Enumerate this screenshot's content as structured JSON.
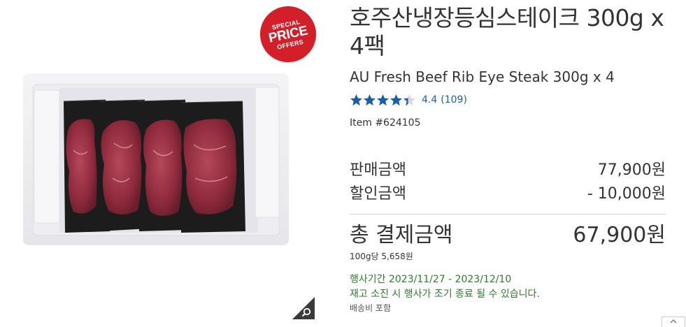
{
  "badge": {
    "line1": "SPECIAL",
    "line2": "PRICE",
    "line3": "OFFERS"
  },
  "product": {
    "title_ko": "호주산냉장등심스테이크 300g x 4팩",
    "title_en": "AU Fresh Beef Rib Eye Steak 300g x 4",
    "rating_value": "4.4",
    "rating_stars": 4.4,
    "rating_count": "(109)",
    "item_number": "Item #624105"
  },
  "pricing": {
    "sale_label": "판매금액",
    "sale_value": "77,900원",
    "discount_label": "할인금액",
    "discount_value": "- 10,000원",
    "total_label": "총 결제금액",
    "total_value": "67,900원",
    "unit_price": "100g당 5,658원"
  },
  "promotion": {
    "period": "행사기간 2023/11/27 - 2023/12/10",
    "note": "재고 소진 시 행사가 조기 종료 될 수 있습니다.",
    "shipping": "배송비 포함"
  },
  "colors": {
    "badge": "#d31f2a",
    "star": "#1a5fa6",
    "promo_text": "#2d7d2d"
  },
  "icons": {
    "zoom": "magnifier-icon",
    "scroll_top": "chevron-up-icon"
  }
}
